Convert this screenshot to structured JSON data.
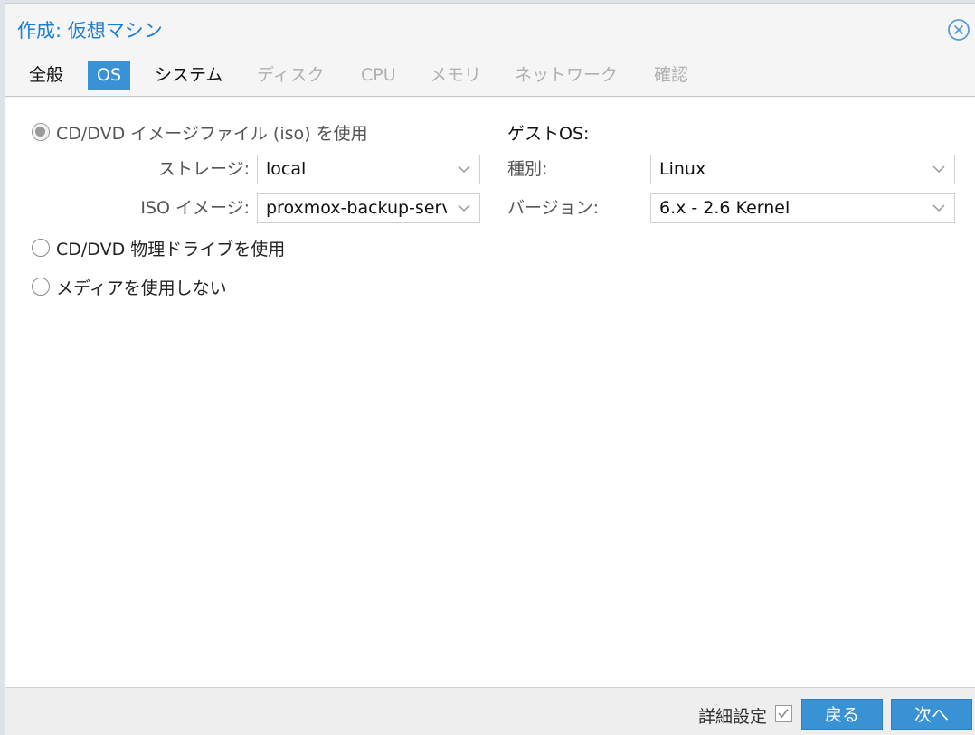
{
  "window": {
    "title": "作成: 仮想マシン"
  },
  "tabs": [
    {
      "label": "全般",
      "state": "enabled"
    },
    {
      "label": "OS",
      "state": "active"
    },
    {
      "label": "システム",
      "state": "enabled"
    },
    {
      "label": "ディスク",
      "state": "disabled"
    },
    {
      "label": "CPU",
      "state": "disabled"
    },
    {
      "label": "メモリ",
      "state": "disabled"
    },
    {
      "label": "ネットワーク",
      "state": "disabled"
    },
    {
      "label": "確認",
      "state": "disabled"
    }
  ],
  "media": {
    "options": [
      {
        "label": "CD/DVD イメージファイル (iso) を使用",
        "checked": true
      },
      {
        "label": "CD/DVD 物理ドライブを使用",
        "checked": false
      },
      {
        "label": "メディアを使用しない",
        "checked": false
      }
    ],
    "storage": {
      "label": "ストレージ:",
      "value": "local"
    },
    "iso": {
      "label": "ISO イメージ:",
      "value": "proxmox-backup-serve"
    }
  },
  "guest_os": {
    "heading": "ゲストOS:",
    "type": {
      "label": "種別:",
      "value": "Linux"
    },
    "version": {
      "label": "バージョン:",
      "value": "6.x - 2.6 Kernel"
    }
  },
  "footer": {
    "advanced_label": "詳細設定",
    "advanced_checked": true,
    "back_label": "戻る",
    "next_label": "次へ"
  },
  "colors": {
    "accent": "#3892d4",
    "title": "#1e7fcf"
  }
}
